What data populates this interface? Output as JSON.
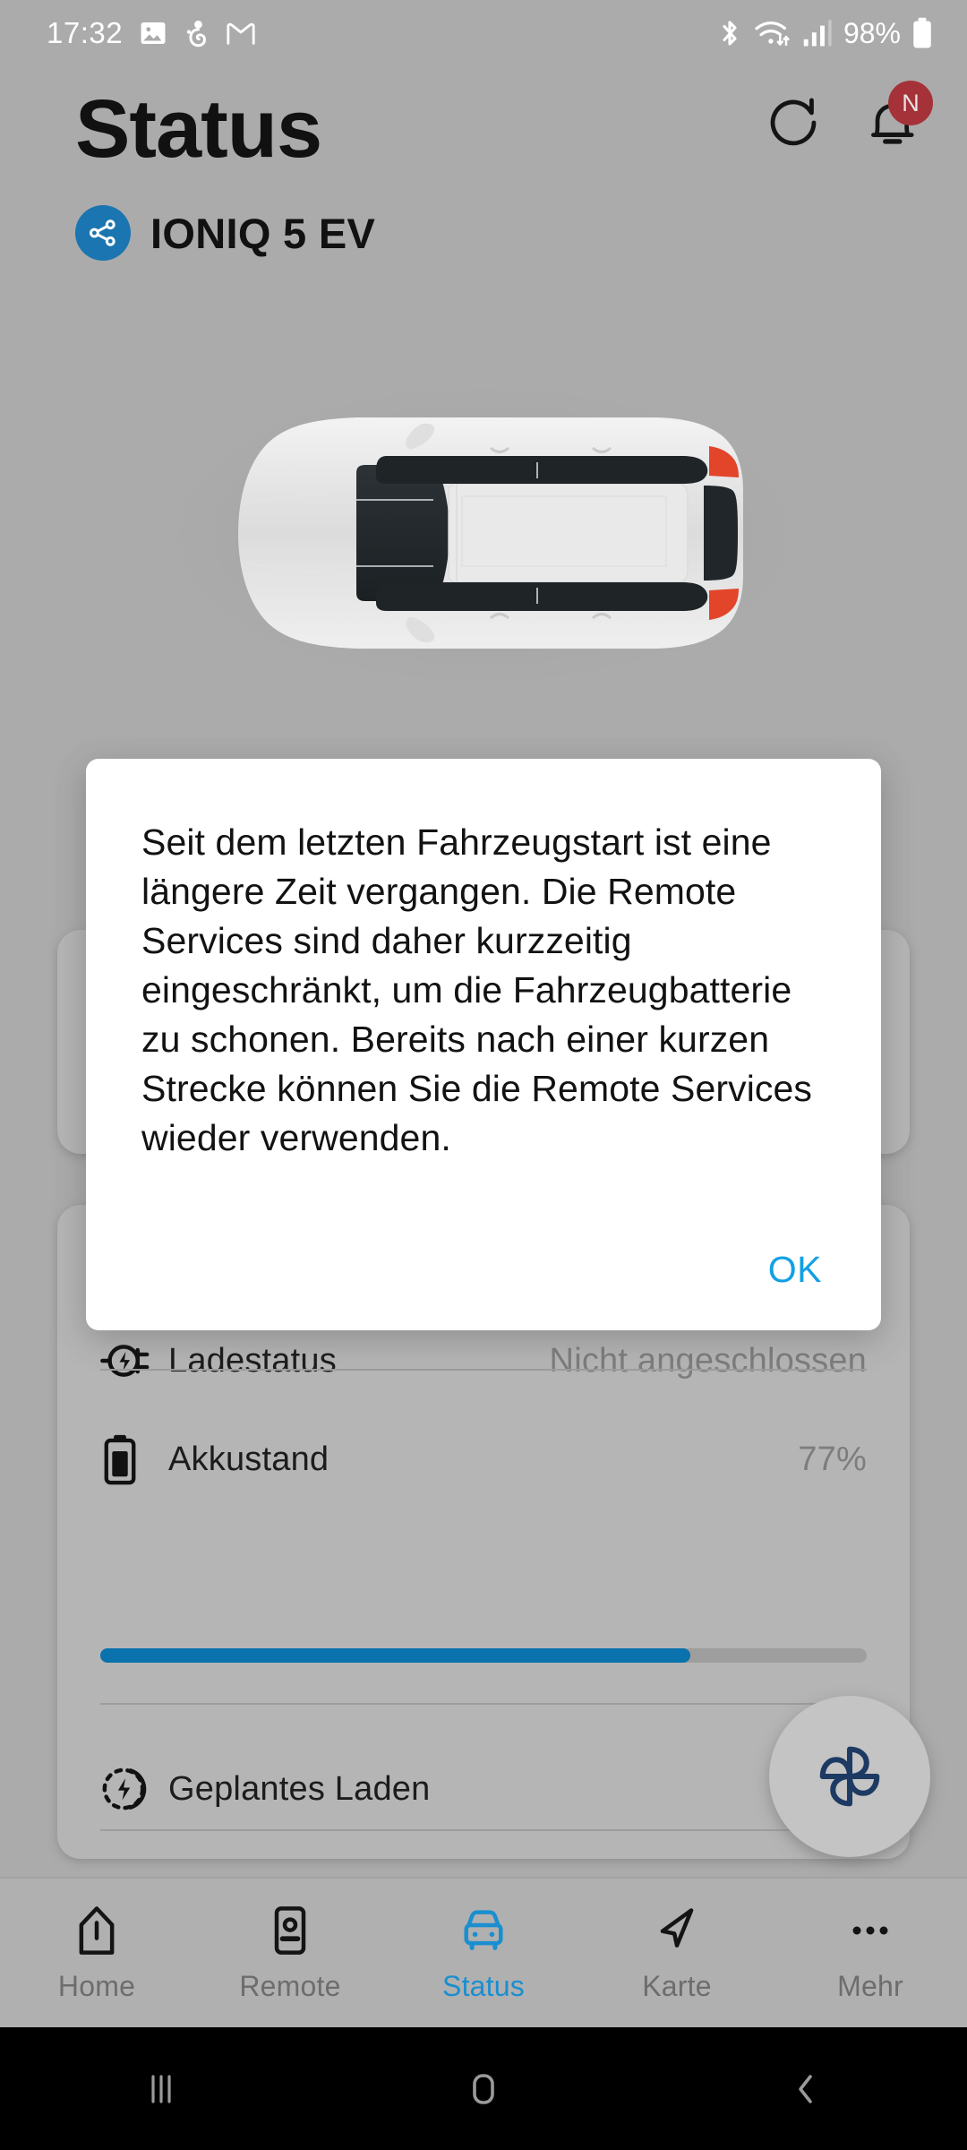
{
  "status_bar": {
    "time": "17:32",
    "battery_percent": "98%",
    "left_icons": [
      "gallery-icon",
      "person-share-icon",
      "gmail-icon"
    ],
    "right_icons": [
      "bluetooth-icon",
      "wifi-icon",
      "signal-icon",
      "battery-icon"
    ]
  },
  "header": {
    "title": "Status",
    "vehicle_name": "IONIQ 5 EV",
    "share_icon": "share-nodes-icon",
    "refresh_icon": "refresh-icon",
    "bell_icon": "bell-icon",
    "bell_badge": "N",
    "badge_color": "#a53238",
    "share_badge_color": "#1a75b0"
  },
  "vehicle_image": {
    "alt": "top-down view of white IONIQ 5 EV"
  },
  "status_card": {
    "rows": [
      {
        "icon": "charging-plug-icon",
        "label": "Ladestatus",
        "value": "Nicht angeschlossen"
      },
      {
        "icon": "battery-level-icon",
        "label": "Akkustand",
        "value": "77%"
      },
      {
        "icon": "scheduled-charging-icon",
        "label": "Geplantes Laden",
        "value": ""
      }
    ],
    "battery_progress_percent": 77,
    "progress_color": "#0a72ad"
  },
  "fab": {
    "icon": "fan-icon",
    "icon_color": "#1d3a63"
  },
  "dialog": {
    "message": "Seit dem letzten Fahrzeugstart ist eine längere Zeit vergangen. Die Remote Services sind daher kurzzeitig eingeschränkt, um die Fahrzeugbatterie zu schonen. Bereits nach einer kurzen Strecke können Sie die Remote Services wieder verwenden.",
    "ok_label": "OK",
    "ok_color": "#12a0e4"
  },
  "bottom_nav": {
    "active_color": "#1a8fd0",
    "items": [
      {
        "label": "Home",
        "icon": "home-icon",
        "active": false
      },
      {
        "label": "Remote",
        "icon": "remote-icon",
        "active": false
      },
      {
        "label": "Status",
        "icon": "car-icon",
        "active": true
      },
      {
        "label": "Karte",
        "icon": "navigate-icon",
        "active": false
      },
      {
        "label": "Mehr",
        "icon": "more-dots-icon",
        "active": false
      }
    ]
  },
  "system_nav": {
    "recents": "recents-icon",
    "home": "home-square-icon",
    "back": "back-chevron-icon"
  }
}
